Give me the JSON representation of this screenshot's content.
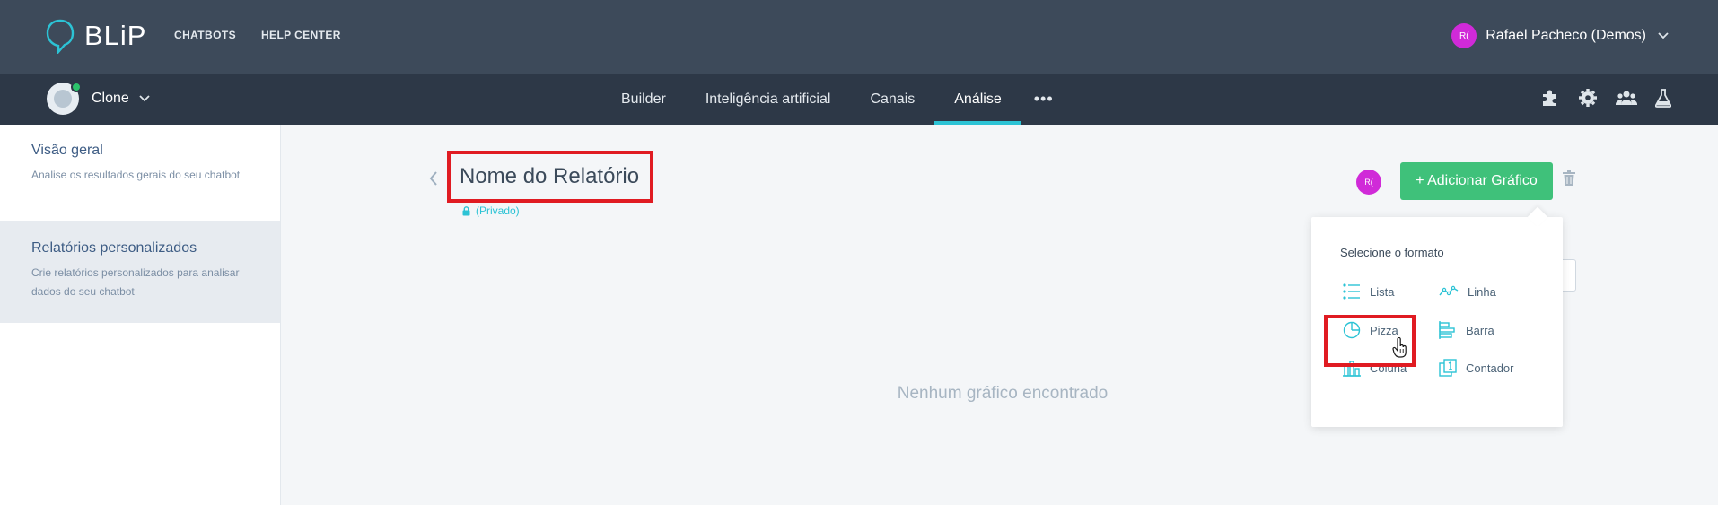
{
  "header": {
    "logo_text": "BLiP",
    "nav": [
      "CHATBOTS",
      "HELP CENTER"
    ],
    "user": {
      "avatar_initials": "R(",
      "name": "Rafael Pacheco (Demos)",
      "avatar_color": "#d02ad8"
    }
  },
  "subheader": {
    "bot_name": "Clone",
    "tabs": [
      {
        "label": "Builder",
        "active": false
      },
      {
        "label": "Inteligência artificial",
        "active": false
      },
      {
        "label": "Canais",
        "active": false
      },
      {
        "label": "Análise",
        "active": true
      }
    ],
    "more_label": "•••",
    "tool_icons": [
      "puzzle-icon",
      "gear-icon",
      "team-icon",
      "flask-icon"
    ]
  },
  "sidebar": {
    "items": [
      {
        "title": "Visão geral",
        "desc": "Analise os resultados gerais do seu chatbot",
        "active": false
      },
      {
        "title": "Relatórios personalizados",
        "desc": "Crie relatórios personalizados para analisar dados do seu chatbot",
        "active": true
      }
    ]
  },
  "report": {
    "title": "Nome do Relatório",
    "privacy": "(Privado)",
    "owner_initials": "R(",
    "add_button": "+ Adicionar Gráfico",
    "empty_text": "Nenhum gráfico encontrado"
  },
  "format_menu": {
    "title": "Selecione o formato",
    "options": [
      {
        "label": "Lista",
        "icon": "list-icon"
      },
      {
        "label": "Linha",
        "icon": "line-chart-icon"
      },
      {
        "label": "Pizza",
        "icon": "pie-chart-icon"
      },
      {
        "label": "Barra",
        "icon": "bar-chart-icon"
      },
      {
        "label": "Coluna",
        "icon": "column-chart-icon"
      },
      {
        "label": "Contador",
        "icon": "counter-icon"
      }
    ]
  },
  "colors": {
    "accent": "#2cc3d5",
    "primary_button": "#3fc17a",
    "highlight_box": "#e01b22",
    "topbar": "#3d4a5a",
    "subbar": "#2d3847"
  }
}
